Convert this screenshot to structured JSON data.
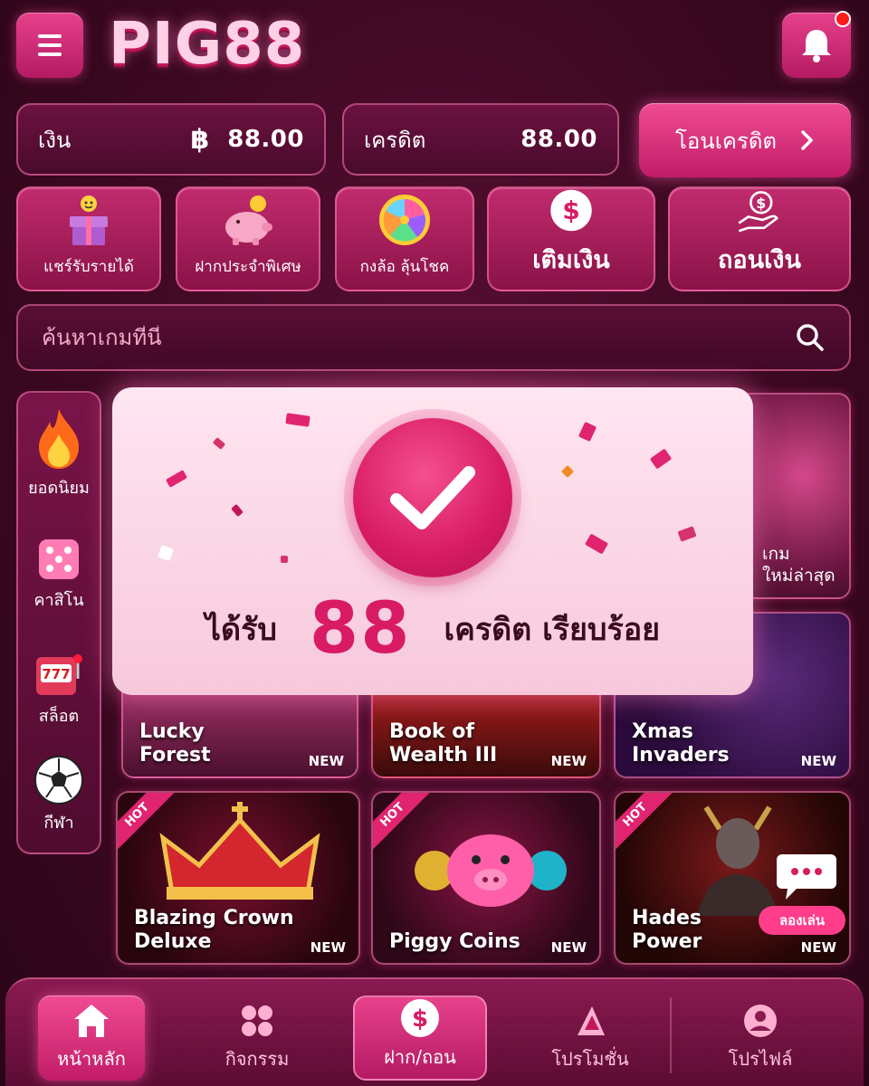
{
  "app": {
    "logo": "PIG88"
  },
  "balance": {
    "label": "เงิน",
    "currency_symbol": "฿",
    "value": "88.00"
  },
  "credit": {
    "label": "เครดิต",
    "value": "88.00"
  },
  "transfer_button": {
    "label": "โอนเครดิต"
  },
  "quick_actions": [
    {
      "label": "แชร์รับรายได้",
      "icon": "gift-icon"
    },
    {
      "label": "ฝากประจำพิเศษ",
      "icon": "piggy-bank-icon"
    },
    {
      "label": "กงล้อ ลุ้นโชค",
      "icon": "wheel-icon"
    },
    {
      "label": "เติมเงิน",
      "icon": "dollar-circle-icon"
    },
    {
      "label": "ถอนเงิน",
      "icon": "hand-money-icon"
    }
  ],
  "search": {
    "placeholder": "ค้นหาเกมที่นี่"
  },
  "sidebar": {
    "items": [
      {
        "label": "ยอดนิยม",
        "icon": "fire-icon"
      },
      {
        "label": "คาสิโน",
        "icon": "dice-icon"
      },
      {
        "label": "สล็อต",
        "icon": "slot-machine-icon"
      },
      {
        "label": "กีฬา",
        "icon": "soccer-ball-icon"
      }
    ]
  },
  "games": {
    "new_badge": "NEW",
    "hot_badge": "HOT",
    "top_right_title": [
      "เกม",
      "ใหม่ล่าสุด"
    ],
    "row2": [
      {
        "title": [
          "Lucky",
          "Forest"
        ]
      },
      {
        "title": [
          "Book of",
          "Wealth III"
        ]
      },
      {
        "title": [
          "Xmas",
          "Invaders"
        ]
      }
    ],
    "row3": [
      {
        "title": [
          "Blazing Crown",
          "Deluxe"
        ]
      },
      {
        "title": [
          "Piggy Coins"
        ]
      },
      {
        "title": [
          "Hades",
          "Power"
        ]
      }
    ],
    "try_button": "ลองเล่น"
  },
  "popup": {
    "prefix": "ได้รับ",
    "amount": "88",
    "suffix": "เครดิต เรียบร้อย"
  },
  "bottom_nav": [
    {
      "label": "หน้าหลัก",
      "icon": "home-icon"
    },
    {
      "label": "กิจกรรม",
      "icon": "grid-icon"
    },
    {
      "label": "ฝาก/ถอน",
      "icon": "dollar-circle-icon"
    },
    {
      "label": "โปรโมชั่น",
      "icon": "megaphone-icon"
    },
    {
      "label": "โปรไฟล์",
      "icon": "profile-icon"
    }
  ],
  "colors": {
    "accent": "#e8418c",
    "background": "#3a0820",
    "popup_bg": "#ffe6f0"
  }
}
